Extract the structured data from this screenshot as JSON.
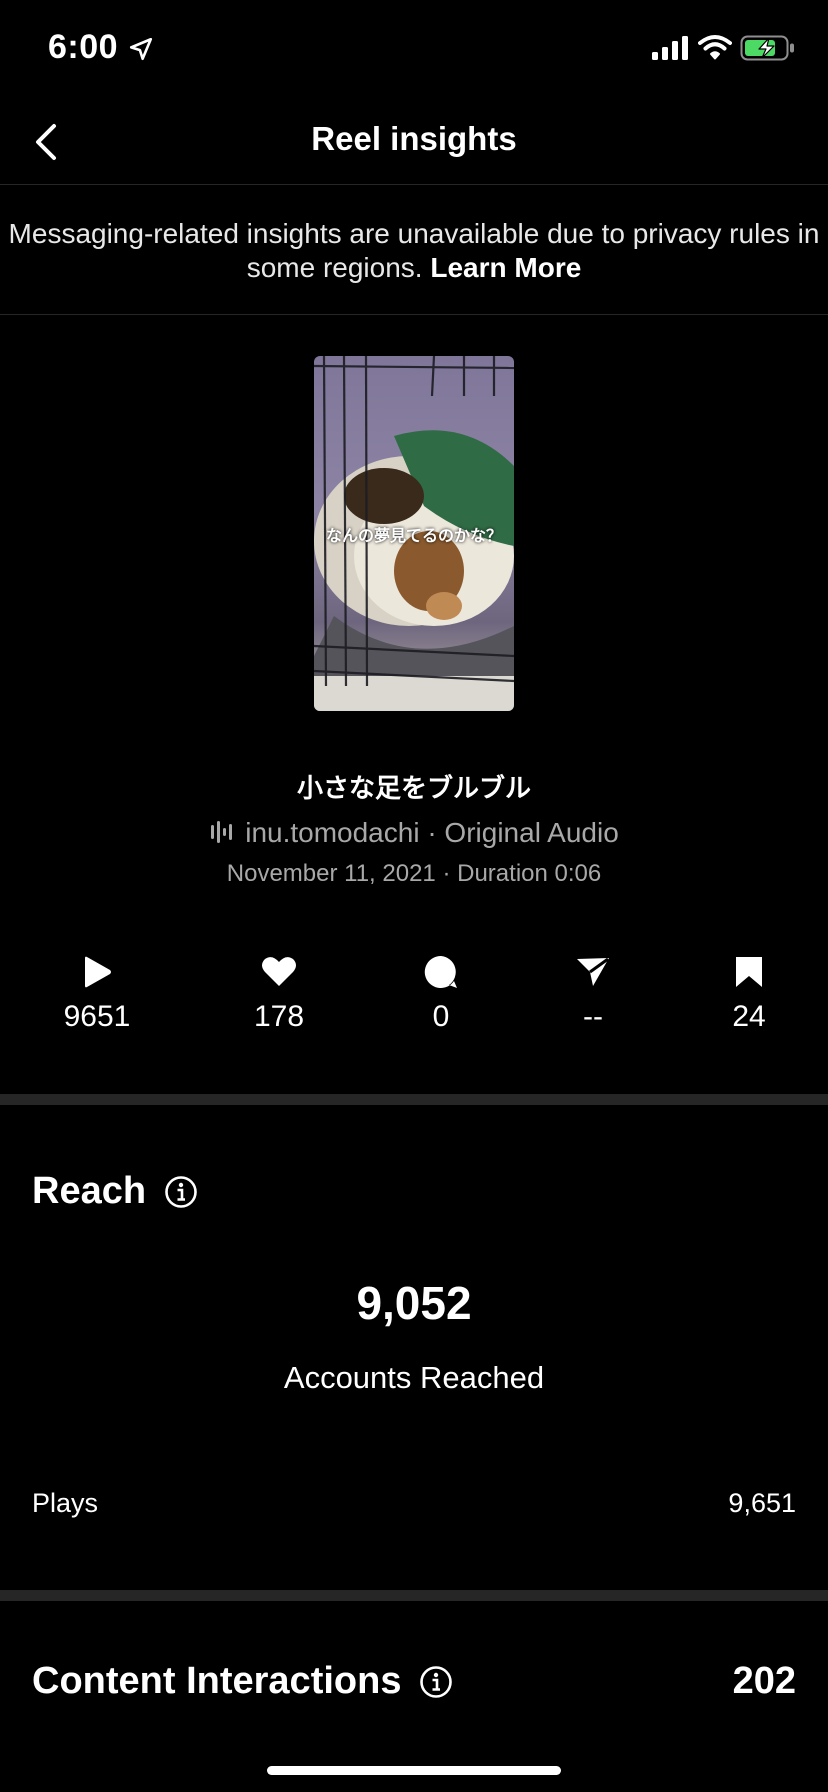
{
  "status_bar": {
    "time": "6:00"
  },
  "nav": {
    "title": "Reel insights"
  },
  "notice": {
    "text": "Messaging-related insights are unavailable due to privacy rules in some regions.",
    "link": "Learn More"
  },
  "reel": {
    "thumbnail_caption": "なんの夢見てるのかな？",
    "title": "小さな足をブルブル",
    "audio": "inu.tomodachi · Original Audio",
    "date": "November 11, 2021",
    "duration": "Duration 0:06"
  },
  "stats": [
    {
      "icon": "play-icon",
      "value": "9651"
    },
    {
      "icon": "heart-icon",
      "value": "178"
    },
    {
      "icon": "comment-icon",
      "value": "0"
    },
    {
      "icon": "share-icon",
      "value": "--"
    },
    {
      "icon": "bookmark-icon",
      "value": "24"
    }
  ],
  "reach": {
    "title": "Reach",
    "accounts_reached_value": "9,052",
    "accounts_reached_label": "Accounts Reached",
    "plays_label": "Plays",
    "plays_value": "9,651"
  },
  "content_interactions": {
    "title": "Content Interactions",
    "total": "202"
  },
  "colors": {
    "background": "#000000",
    "secondary_text": "#a8a8a8",
    "divider": "#262626",
    "battery": "#4cd964"
  }
}
